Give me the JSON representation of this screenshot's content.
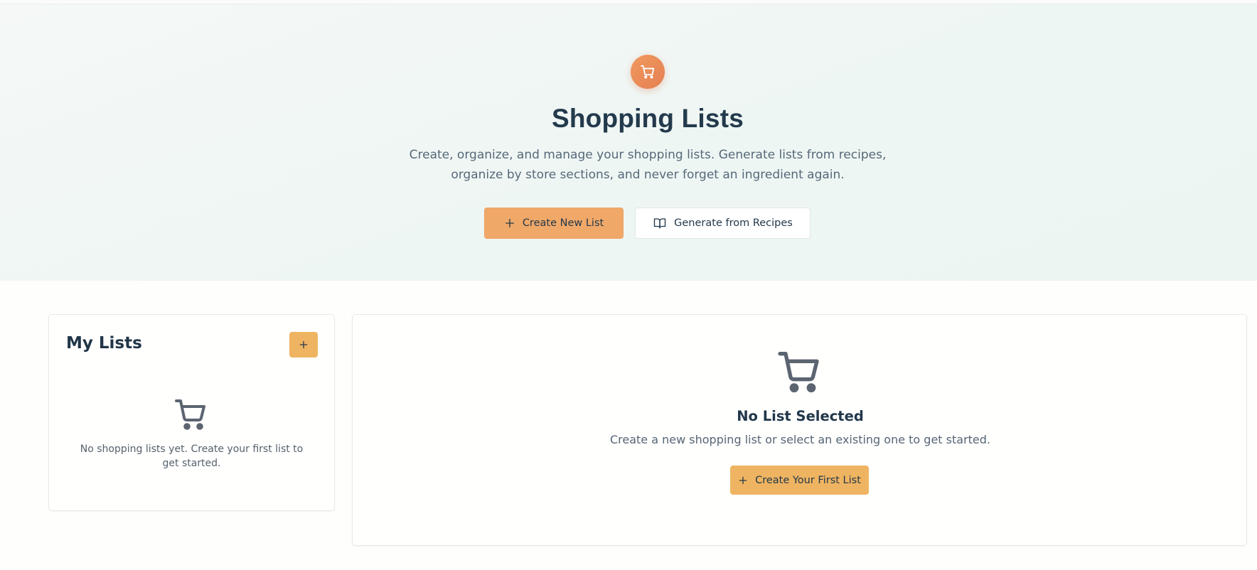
{
  "hero": {
    "icon": "shopping-cart-icon",
    "title": "Shopping Lists",
    "description": "Create, organize, and manage your shopping lists. Generate lists from recipes, organize by store sections, and never forget an ingredient again.",
    "create_button": {
      "label": "Create New List",
      "icon": "plus-icon"
    },
    "generate_button": {
      "label": "Generate from Recipes",
      "icon": "book-open-icon"
    }
  },
  "my_lists": {
    "title": "My Lists",
    "add_button_icon": "plus-icon",
    "empty_icon": "shopping-cart-icon",
    "empty_text": "No shopping lists yet. Create your first list to get started."
  },
  "main_panel": {
    "icon": "shopping-cart-icon",
    "title": "No List Selected",
    "description": "Create a new shopping list or select an existing one to get started.",
    "create_button": {
      "label": "Create Your First List",
      "icon": "plus-icon"
    }
  },
  "colors": {
    "accent_orange": "#f0a868",
    "accent_amber": "#efb461",
    "hero_icon": "#e88654",
    "heading": "#233a4c"
  }
}
